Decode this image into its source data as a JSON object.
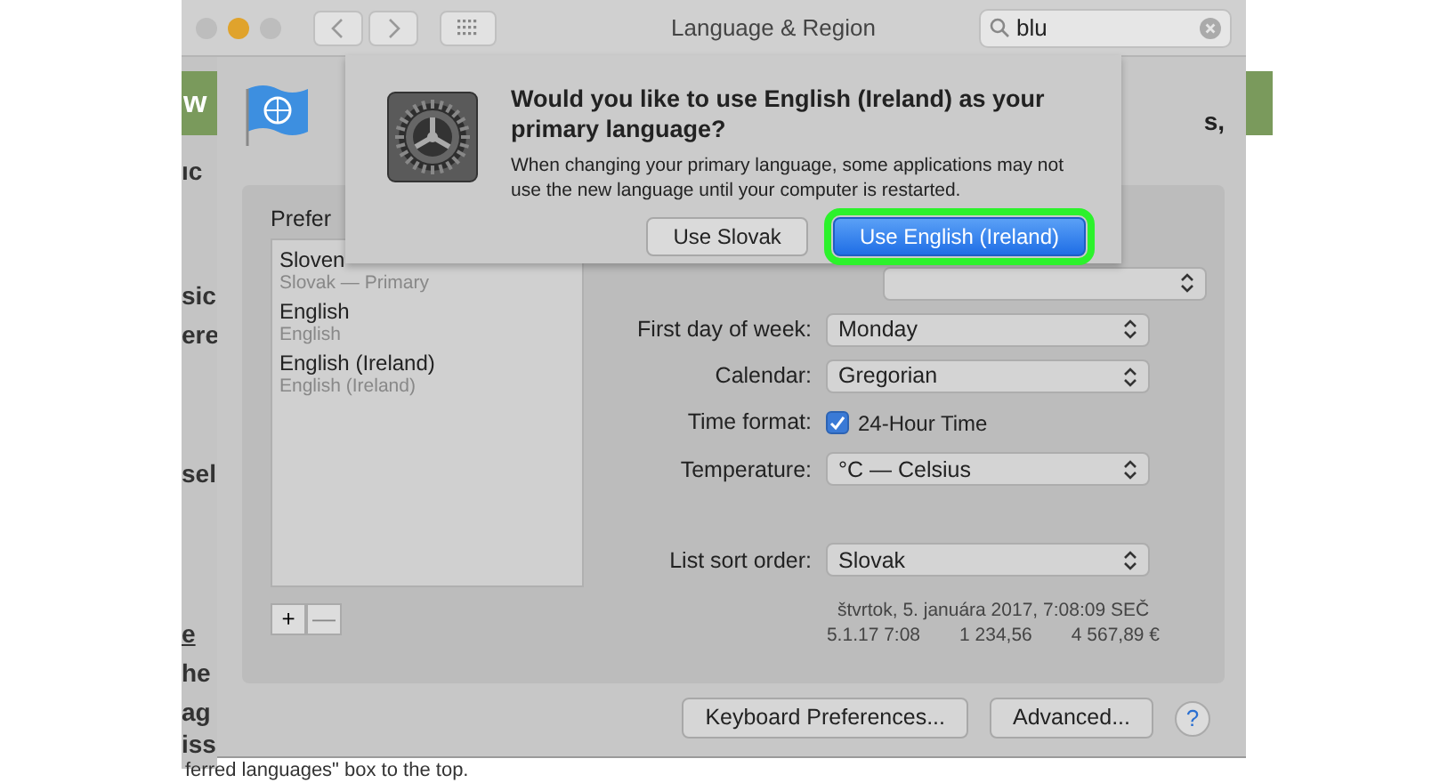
{
  "background": {
    "logo_letter": "w",
    "fragments": [
      {
        "text": "ıc",
        "underlined": false
      },
      {
        "text": "sic",
        "underlined": false
      },
      {
        "text": "ere",
        "underlined": false
      },
      {
        "text": "sel",
        "underlined": false
      },
      {
        "text": "e",
        "underlined": true
      },
      {
        "text": "he",
        "underlined": false
      },
      {
        "text": "ag",
        "underlined": false
      },
      {
        "text": "iss",
        "underlined": false
      }
    ],
    "bottom_text": "ferred languages\" box to the top."
  },
  "window": {
    "title": "Language & Region",
    "search": {
      "value": "blu"
    },
    "header_tail": "s,"
  },
  "preferred": {
    "label": "Prefer",
    "languages": [
      {
        "name": "Sloven",
        "sub": "Slovak — Primary"
      },
      {
        "name": "English",
        "sub": "English"
      },
      {
        "name": "English (Ireland)",
        "sub": "English (Ireland)"
      }
    ],
    "add": "+",
    "remove": "—"
  },
  "settings": [
    {
      "kind": "popup",
      "label": "First day of week:",
      "value": "Monday"
    },
    {
      "kind": "popup",
      "label": "Calendar:",
      "value": "Gregorian"
    },
    {
      "kind": "checkbox",
      "label": "Time format:",
      "value": "24-Hour Time",
      "checked": true
    },
    {
      "kind": "popup",
      "label": "Temperature:",
      "value": "°C — Celsius"
    },
    {
      "kind": "gap"
    },
    {
      "kind": "popup",
      "label": "List sort order:",
      "value": "Slovak"
    }
  ],
  "sample": [
    "štvrtok, 5. januára 2017, 7:08:09 SEČ",
    "5.1.17 7:08",
    "1 234,56",
    "4 567,89 €"
  ],
  "bottom_buttons": [
    "Keyboard Preferences...",
    "Advanced..."
  ],
  "help": "?",
  "dialog": {
    "title": "Would you like to use English (Ireland) as your primary language?",
    "message": "When changing your primary language, some applications may not use the new language until your computer is restarted.",
    "buttons": [
      {
        "label": "Use Slovak",
        "default": false,
        "highlighted": false
      },
      {
        "label": "Use English (Ireland)",
        "default": true,
        "highlighted": true
      }
    ]
  }
}
